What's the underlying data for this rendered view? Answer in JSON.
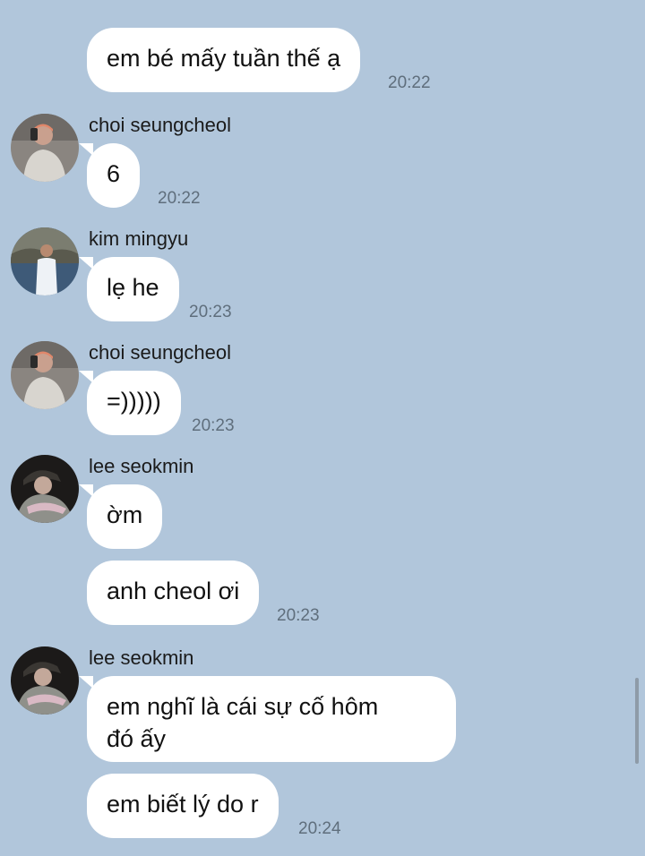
{
  "messages": [
    {
      "text": "em bé mấy tuần thế ạ",
      "time": "20:22"
    },
    {
      "sender": "choi seungcheol",
      "avatar": "avatar-choi",
      "text": "6",
      "time": "20:22"
    },
    {
      "sender": "kim mingyu",
      "avatar": "avatar-kim",
      "text": "lẹ he",
      "time": "20:23"
    },
    {
      "sender": "choi seungcheol",
      "avatar": "avatar-choi",
      "text": "=)))))",
      "time": "20:23"
    },
    {
      "sender": "lee seokmin",
      "avatar": "avatar-lee",
      "text": "ờm"
    },
    {
      "text": "anh cheol ơi",
      "time": "20:23"
    },
    {
      "sender": "lee seokmin",
      "avatar": "avatar-lee",
      "text": "em nghĩ là cái sự cố hôm\nđó ấy"
    },
    {
      "text": "em biết lý do r",
      "time": "20:24"
    }
  ],
  "colors": {
    "background": "#b1c6db",
    "bubble": "#ffffff",
    "time": "#5f6e7c"
  }
}
